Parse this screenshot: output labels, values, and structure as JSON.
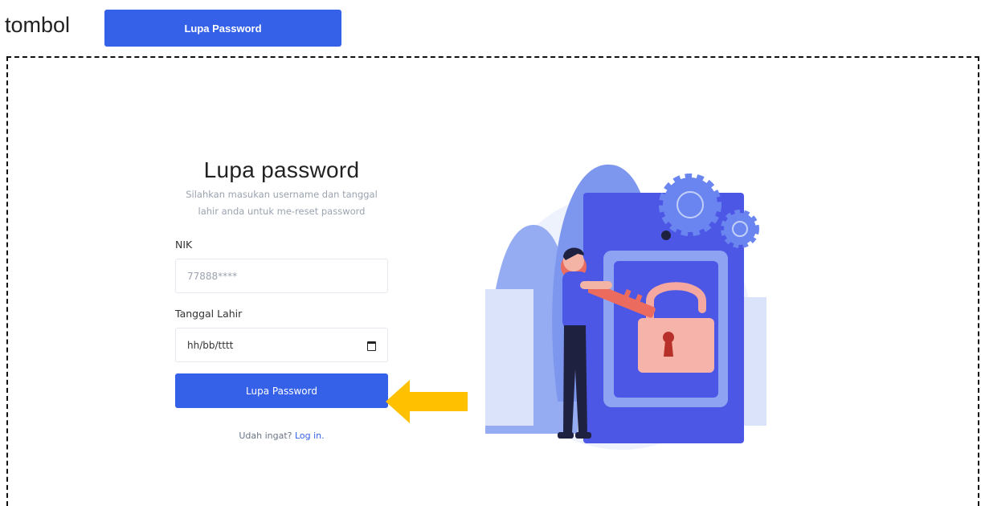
{
  "document": {
    "top_line_left": "",
    "top_line_bold": "",
    "top_line_right": "",
    "tombol_label": "tombol",
    "sample_button_label": "Lupa Password"
  },
  "form": {
    "title": "Lupa password",
    "subtitle_line1": "Silahkan masukan username dan tanggal",
    "subtitle_line2": "lahir anda untuk me-reset password",
    "nik_label": "NIK",
    "nik_placeholder": "77888****",
    "dob_label": "Tanggal Lahir",
    "dob_placeholder": "hh/bb/tttt",
    "submit_label": "Lupa Password",
    "remember_text": "Udah ingat?",
    "login_link": "Log in."
  },
  "annotation": {
    "arrow_color": "#ffc000"
  },
  "illustration": {
    "description": "",
    "icons": [
      "person-holding-key",
      "padlock",
      "gear"
    ]
  },
  "colors": {
    "primary": "#3461e8",
    "accent_arrow": "#ffc000"
  }
}
